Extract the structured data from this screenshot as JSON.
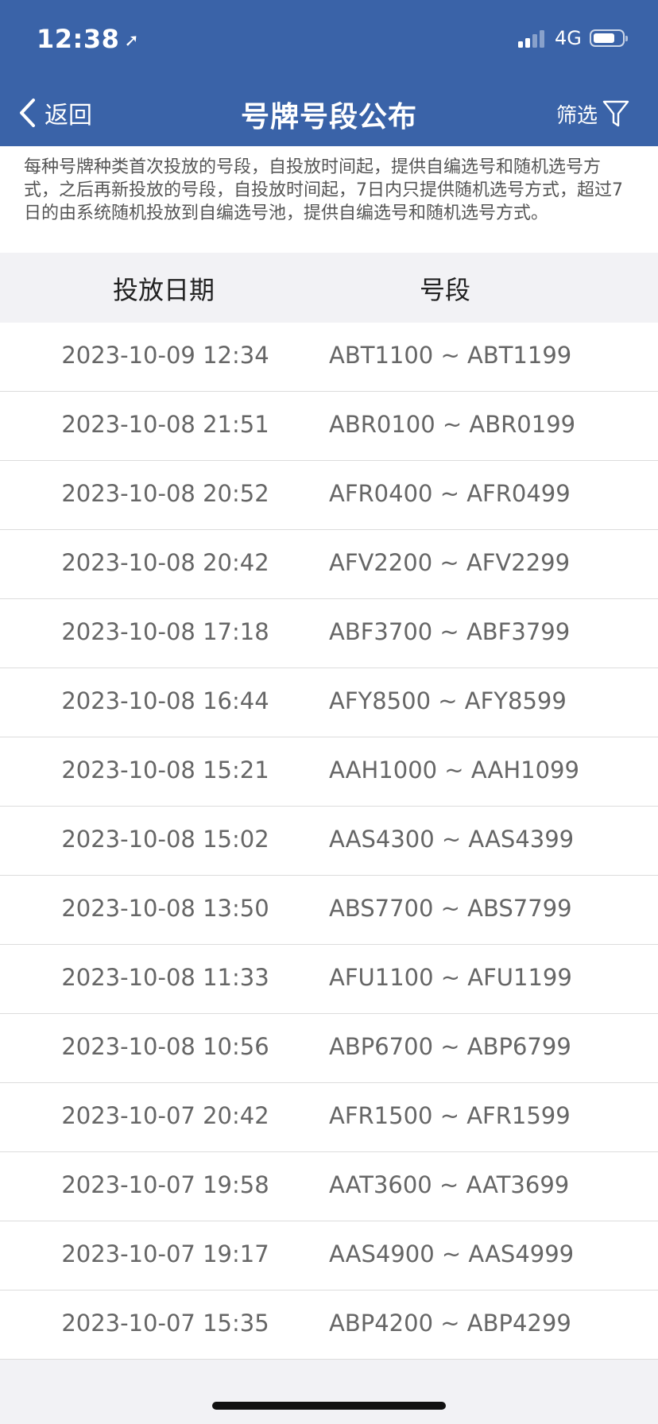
{
  "status_bar": {
    "time": "12:38",
    "network": "4G",
    "battery_level": 0.7,
    "signal_bars": 2
  },
  "nav": {
    "back_label": "返回",
    "title": "号牌号段公布",
    "filter_label": "筛选"
  },
  "notice": "每种号牌种类首次投放的号段，自投放时间起，提供自编选号和随机选号方式，之后再新投放的号段，自投放时间起，7日内只提供随机选号方式，超过7日的由系统随机投放到自编选号池，提供自编选号和随机选号方式。",
  "table": {
    "headers": [
      "投放日期",
      "号段"
    ],
    "rows": [
      {
        "date": "2023-10-09 12:34",
        "range": "ABT1100 ~ ABT1199"
      },
      {
        "date": "2023-10-08 21:51",
        "range": "ABR0100 ~ ABR0199"
      },
      {
        "date": "2023-10-08 20:52",
        "range": "AFR0400 ~ AFR0499"
      },
      {
        "date": "2023-10-08 20:42",
        "range": "AFV2200 ~ AFV2299"
      },
      {
        "date": "2023-10-08 17:18",
        "range": "ABF3700 ~ ABF3799"
      },
      {
        "date": "2023-10-08 16:44",
        "range": "AFY8500 ~ AFY8599"
      },
      {
        "date": "2023-10-08 15:21",
        "range": "AAH1000 ~ AAH1099"
      },
      {
        "date": "2023-10-08 15:02",
        "range": "AAS4300 ~ AAS4399"
      },
      {
        "date": "2023-10-08 13:50",
        "range": "ABS7700 ~ ABS7799"
      },
      {
        "date": "2023-10-08 11:33",
        "range": "AFU1100 ~ AFU1199"
      },
      {
        "date": "2023-10-08 10:56",
        "range": "ABP6700 ~ ABP6799"
      },
      {
        "date": "2023-10-07 20:42",
        "range": "AFR1500 ~ AFR1599"
      },
      {
        "date": "2023-10-07 19:58",
        "range": "AAT3600 ~ AAT3699"
      },
      {
        "date": "2023-10-07 19:17",
        "range": "AAS4900 ~ AAS4999"
      },
      {
        "date": "2023-10-07 15:35",
        "range": "ABP4200 ~ ABP4299"
      }
    ]
  },
  "colors": {
    "header_bg": "#3a63a8",
    "page_bg": "#f2f2f5",
    "row_text": "#666666"
  },
  "icons": {
    "back": "chevron-left-icon",
    "filter": "funnel-icon",
    "location": "location-arrow-icon"
  }
}
